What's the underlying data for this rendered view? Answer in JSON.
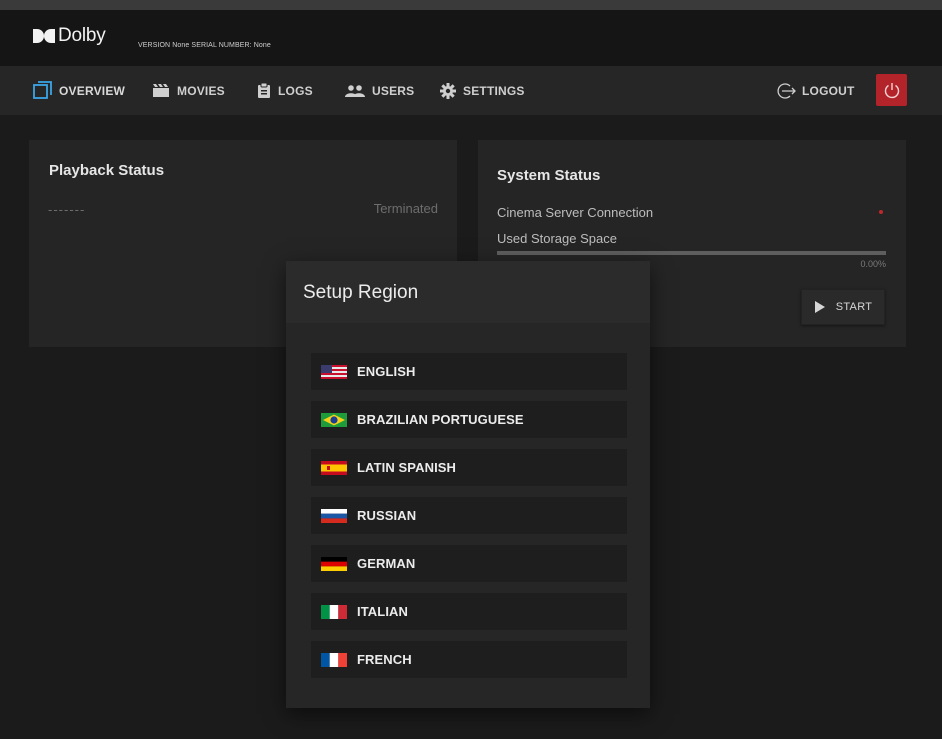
{
  "header": {
    "brand": "Dolby",
    "version_text": "VERSION None SERIAL NUMBER: None"
  },
  "nav": {
    "items": [
      {
        "label": "OVERVIEW",
        "icon": "overview-icon",
        "active": true
      },
      {
        "label": "MOVIES",
        "icon": "clapperboard-icon"
      },
      {
        "label": "LOGS",
        "icon": "clipboard-icon"
      },
      {
        "label": "USERS",
        "icon": "users-icon"
      },
      {
        "label": "SETTINGS",
        "icon": "gear-icon"
      }
    ],
    "logout_label": "LOGOUT",
    "power_icon": "power-icon",
    "power_color": "#b3232a"
  },
  "playback": {
    "title": "Playback Status",
    "title_placeholder": "-------",
    "state": "Terminated"
  },
  "system": {
    "title": "System Status",
    "connection_label": "Cinema Server Connection",
    "connection_status_color": "#c0282b",
    "storage_label": "Used Storage Space",
    "storage_percent_text": "0.00%",
    "storage_fraction": 0.0,
    "start_label": "START"
  },
  "dialog": {
    "title": "Setup Region",
    "languages": [
      {
        "label": "ENGLISH",
        "flag": "us-flag-icon"
      },
      {
        "label": "BRAZILIAN PORTUGUESE",
        "flag": "brazil-flag-icon"
      },
      {
        "label": "LATIN SPANISH",
        "flag": "spain-flag-icon"
      },
      {
        "label": "RUSSIAN",
        "flag": "russia-flag-icon"
      },
      {
        "label": "GERMAN",
        "flag": "germany-flag-icon"
      },
      {
        "label": "ITALIAN",
        "flag": "italy-flag-icon"
      },
      {
        "label": "FRENCH",
        "flag": "france-flag-icon"
      }
    ]
  }
}
